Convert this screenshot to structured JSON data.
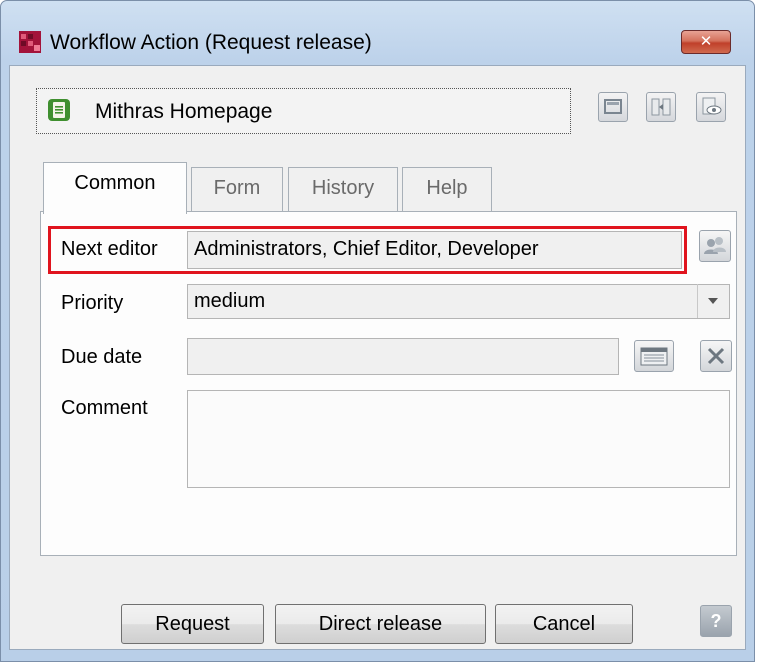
{
  "window": {
    "title": "Workflow Action (Request release)",
    "close_glyph": "✕",
    "icon": "app-icon"
  },
  "object": {
    "label": "Mithras Homepage",
    "icon": "page-icon"
  },
  "toolbar": {
    "icons": [
      "display-icon",
      "compare-icon",
      "preview-icon"
    ]
  },
  "tabs": [
    {
      "label": "Common",
      "active": true
    },
    {
      "label": "Form",
      "active": false
    },
    {
      "label": "History",
      "active": false
    },
    {
      "label": "Help",
      "active": false
    }
  ],
  "form": {
    "next_editor_label": "Next editor",
    "next_editor_value": "Administrators, Chief Editor, Developer",
    "priority_label": "Priority",
    "priority_value": "medium",
    "due_date_label": "Due date",
    "due_date_value": "",
    "comment_label": "Comment",
    "comment_value": ""
  },
  "buttons": {
    "request": "Request",
    "direct_release": "Direct release",
    "cancel": "Cancel",
    "help": "?"
  },
  "colors": {
    "highlight": "#e0141e",
    "title_bar": "#bdd2ea",
    "close_button": "#c0402a"
  }
}
